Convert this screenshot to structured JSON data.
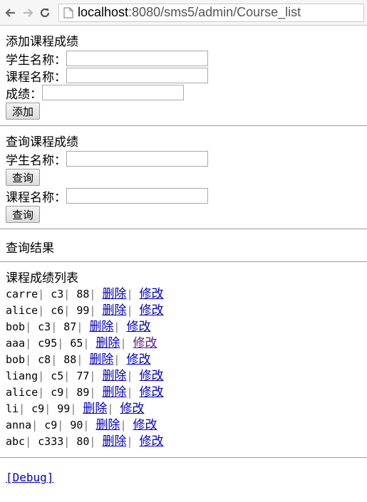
{
  "browser": {
    "url_host": "localhost",
    "url_rest": ":8080/sms5/admin/Course_list"
  },
  "add_section": {
    "title": "添加课程成绩",
    "student_label": "学生名称：",
    "course_label": "课程名称：",
    "score_label": "成绩：",
    "add_button": "添加"
  },
  "query_section": {
    "title": "查询课程成绩",
    "student_label": "学生名称：",
    "query_button_1": "查询",
    "course_label": "课程名称：",
    "query_button_2": "查询"
  },
  "result_title": "查询结果",
  "list": {
    "title": "课程成绩列表",
    "delete_label": "删除",
    "edit_label": "修改",
    "rows": [
      {
        "student": "carre",
        "course": "c3",
        "score": "88"
      },
      {
        "student": "alice",
        "course": "c6",
        "score": "99"
      },
      {
        "student": "bob",
        "course": "c3",
        "score": "87"
      },
      {
        "student": "aaa",
        "course": "c95",
        "score": "65"
      },
      {
        "student": "bob",
        "course": "c8",
        "score": "88"
      },
      {
        "student": "liang",
        "course": "c5",
        "score": "77"
      },
      {
        "student": "alice",
        "course": "c9",
        "score": "89"
      },
      {
        "student": "li",
        "course": "c9",
        "score": "99"
      },
      {
        "student": "anna",
        "course": "c9",
        "score": "90"
      },
      {
        "student": "abc",
        "course": "c333",
        "score": "80"
      }
    ]
  },
  "debug_link": "[Debug]"
}
